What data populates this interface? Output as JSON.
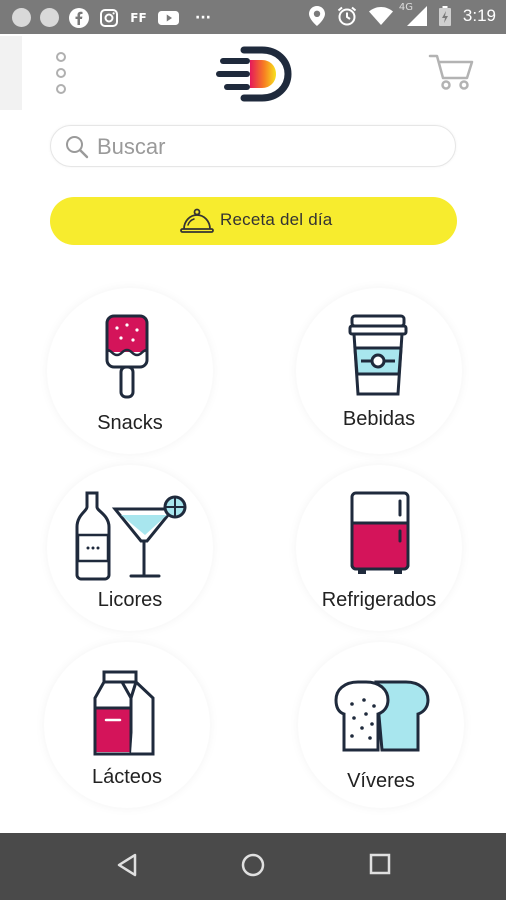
{
  "status_bar": {
    "notif_icons": [
      "circle-dot-icon",
      "circle-dot-icon",
      "facebook-icon",
      "instagram-icon",
      "ff-icon",
      "youtube-icon",
      "more-icon"
    ],
    "ff_label": "FF",
    "more_label": "···",
    "network": "4G",
    "time": "3:19"
  },
  "header": {
    "menu_icon": "kebab-menu-icon",
    "logo_icon": "speed-d-logo-icon",
    "cart_icon": "shopping-cart-icon"
  },
  "search": {
    "placeholder": "Buscar"
  },
  "recipe_button": {
    "label": "Receta del día",
    "icon": "cloche-icon"
  },
  "categories": [
    {
      "label": "Snacks",
      "icon": "popsicle-icon"
    },
    {
      "label": "Bebidas",
      "icon": "coffee-cup-icon"
    },
    {
      "label": "Licores",
      "icon": "bottle-cocktail-icon"
    },
    {
      "label": "Refrigerados",
      "icon": "fridge-icon"
    },
    {
      "label": "Lácteos",
      "icon": "milk-carton-icon"
    },
    {
      "label": "Víveres",
      "icon": "bread-icon"
    }
  ],
  "colors": {
    "accent_yellow": "#f7ec2e",
    "accent_magenta": "#d4145a",
    "accent_cyan": "#a8e6ee",
    "icon_dark": "#1f2a3c"
  },
  "nav_bar": {
    "buttons": [
      "back-icon",
      "home-icon",
      "recents-icon"
    ]
  }
}
